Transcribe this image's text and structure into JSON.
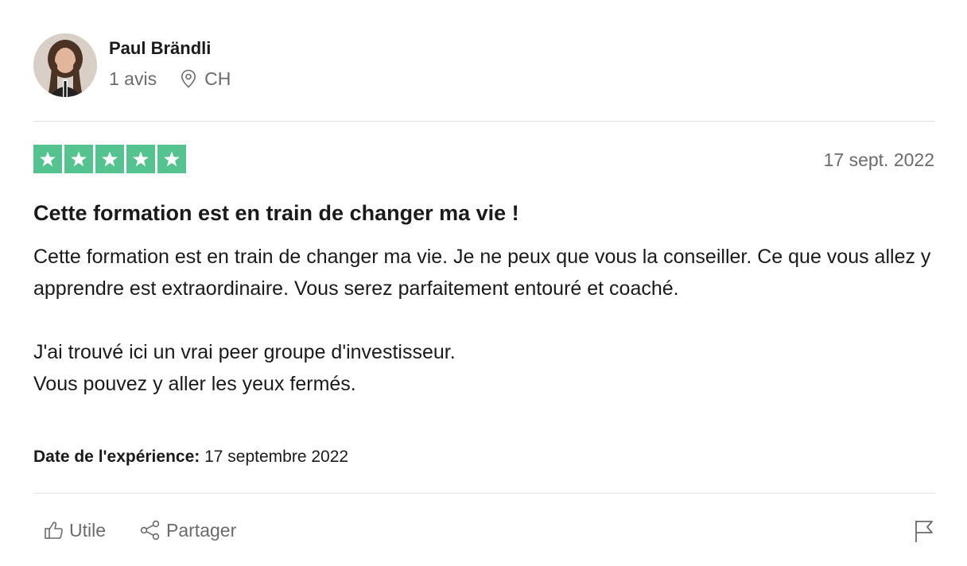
{
  "reviewer": {
    "name": "Paul Brändli",
    "review_count": "1 avis",
    "country": "CH"
  },
  "review": {
    "rating": 5,
    "date": "17 sept. 2022",
    "title": "Cette formation est en train de changer ma vie !",
    "paragraphs": [
      "Cette formation est en train de changer ma vie. Je ne peux que vous la conseiller. Ce que vous allez y apprendre est extraordinaire. Vous serez parfaitement entouré et coaché.",
      "J'ai trouvé ici un vrai peer groupe d'investisseur.\nVous pouvez y aller les yeux fermés."
    ],
    "experience_label": "Date de l'expérience:",
    "experience_date": "17 septembre 2022"
  },
  "actions": {
    "useful_label": "Utile",
    "share_label": "Partager"
  },
  "colors": {
    "star_green": "#55c38f",
    "muted_text": "#6b6b6b",
    "divider": "#e0e0e0"
  },
  "icons": {
    "location": "location-pin-icon",
    "useful": "thumbs-up-icon",
    "share": "share-icon",
    "flag": "flag-icon",
    "star": "star-icon"
  }
}
